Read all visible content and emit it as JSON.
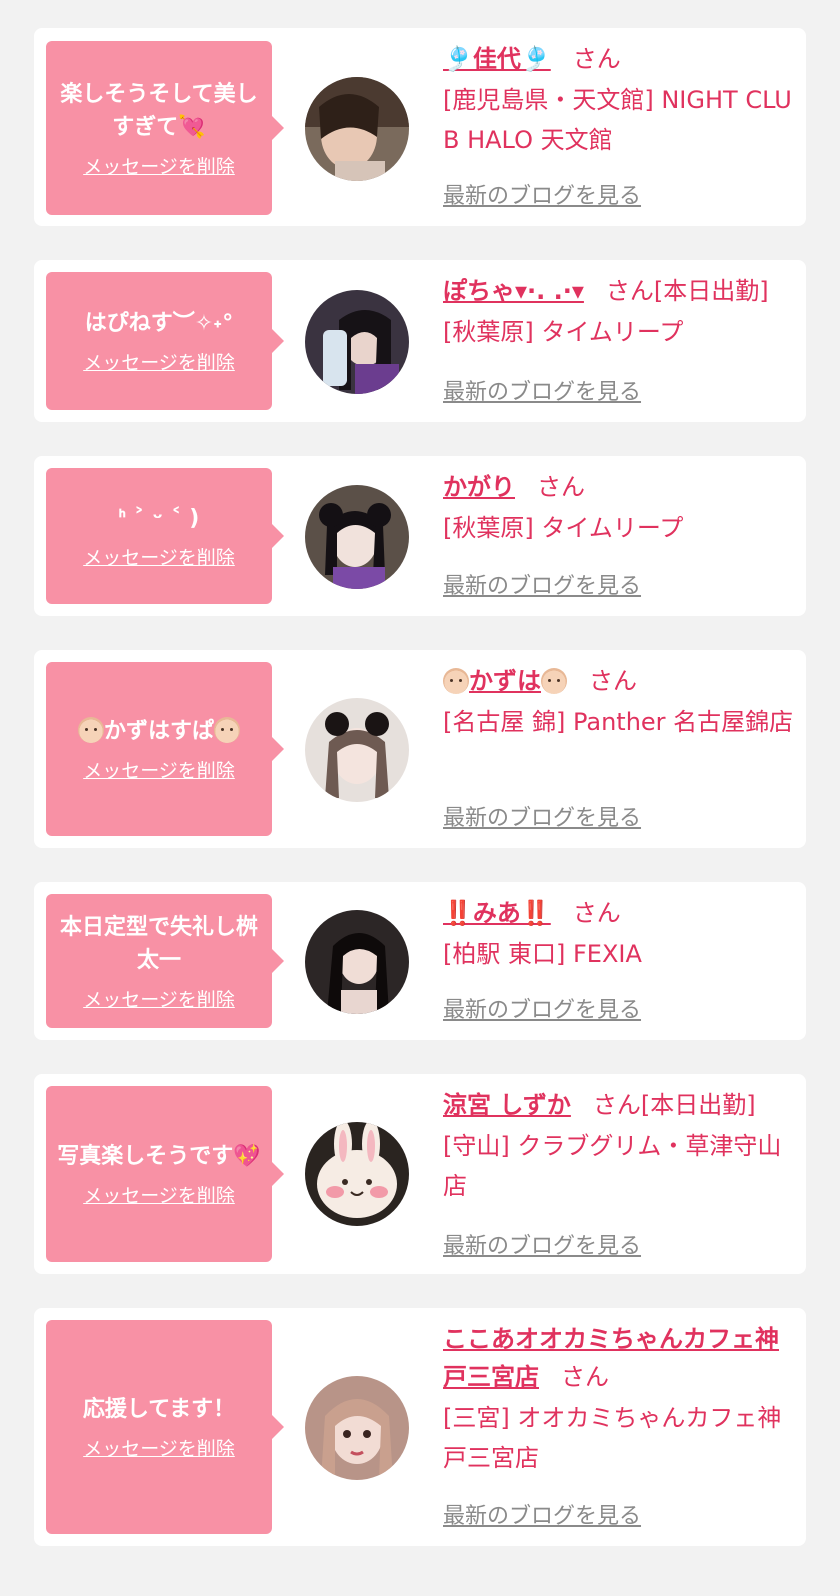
{
  "colors": {
    "background": "#f2f2f2",
    "card": "#ffffff",
    "bubble": "#f891a5",
    "name": "#e0325e",
    "blog_link": "#8a8a8a"
  },
  "items": [
    {
      "message": "楽しそうそして美しすぎて💘",
      "delete_label": "メッセージを削除",
      "name": "🎐佳代🎐",
      "honorific": "さん",
      "status": "",
      "shop": "[鹿児島県・天文館] NIGHT CLUB HALO 天文館",
      "blog_label": "最新のブログを見る",
      "avatar_icon": "avatar-photo"
    },
    {
      "message": "はぴねす︶✧˖°",
      "delete_label": "メッセージを削除",
      "name": "ぽちゃ▾·. .·▾",
      "honorific": "さん",
      "status": "[本日出勤]",
      "shop": "[秋葉原] タイムリープ",
      "blog_label": "最新のブログを見る",
      "avatar_icon": "avatar-photo"
    },
    {
      "message": "ᑋ ˃ ᵕ ˂ )",
      "delete_label": "メッセージを削除",
      "name": "かがり",
      "honorific": "さん",
      "status": "",
      "shop": "[秋葉原] タイムリープ",
      "blog_label": "最新のブログを見る",
      "avatar_icon": "avatar-photo"
    },
    {
      "message": "かずはすぱ",
      "delete_label": "メッセージを削除",
      "name": "かずは",
      "honorific": "さん",
      "status": "",
      "shop": "[名古屋 錦] Panther 名古屋錦店",
      "blog_label": "最新のブログを見る",
      "avatar_icon": "avatar-photo"
    },
    {
      "message": "本日定型で失礼し桝太一",
      "delete_label": "メッセージを削除",
      "name": "‼️みあ‼️",
      "honorific": "さん",
      "status": "",
      "shop": "[柏駅 東口] FEXIA",
      "blog_label": "最新のブログを見る",
      "avatar_icon": "avatar-photo"
    },
    {
      "message": "写真楽しそうです💖",
      "delete_label": "メッセージを削除",
      "name": "涼宮 しずか",
      "honorific": "さん",
      "status": "[本日出勤]",
      "shop": "[守山] クラブグリム・草津守山店",
      "blog_label": "最新のブログを見る",
      "avatar_icon": "avatar-bunny"
    },
    {
      "message": "応援してます！",
      "delete_label": "メッセージを削除",
      "name": "ここあオオカミちゃんカフェ神戸三宮店",
      "honorific": "さん",
      "status": "",
      "shop": "[三宮] オオカミちゃんカフェ神戸三宮店",
      "blog_label": "最新のブログを見る",
      "avatar_icon": "avatar-photo"
    }
  ]
}
